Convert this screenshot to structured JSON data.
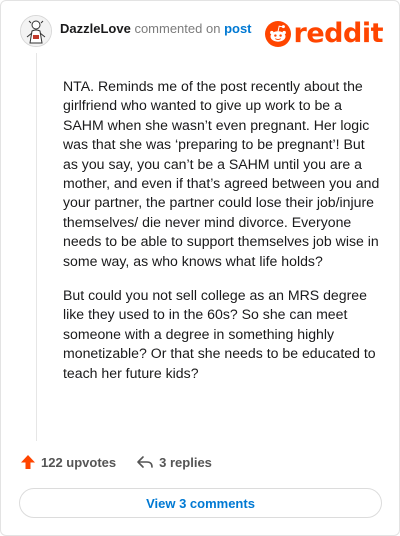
{
  "comment": {
    "author": "DazzleLove",
    "action_text": "commented on",
    "target_text": "post",
    "paragraphs": [
      "NTA. Reminds me of the post recently about the girlfriend who wanted to give up work to be a SAHM when she wasn’t even pregnant. Her logic was that she was ‘preparing to be pregnant’! But as you say, you can’t be a SAHM until you are a mother, and even if that’s agreed between you and your partner, the partner could lose their job/injure themselves/ die never mind divorce. Everyone needs to be able to support themselves job wise in some way, as who knows what life holds?",
      "But could you not sell college as an MRS degree like they used to in the 60s? So she can meet someone with a degree in something highly monetizable? Or that she needs to be educated to teach her future kids?"
    ]
  },
  "brand": {
    "name": "reddit",
    "color": "#ff4500"
  },
  "actions": {
    "upvotes": "122 upvotes",
    "replies": "3 replies"
  },
  "view_comments": "View 3 comments",
  "colors": {
    "accent": "#ff4500",
    "link": "#0079d3",
    "muted": "#7c7c7c"
  },
  "icons": {
    "avatar": "user-avatar",
    "brand": "reddit-snoo-icon",
    "upvote": "upvote-arrow-icon",
    "reply": "reply-arrow-icon"
  }
}
